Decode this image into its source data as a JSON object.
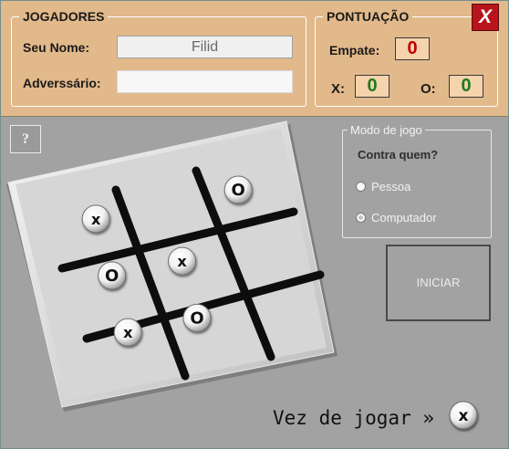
{
  "players": {
    "title": "JOGADORES",
    "name_label": "Seu Nome:",
    "name_value": "Filid",
    "opponent_label": "Adverssário:",
    "opponent_value": ""
  },
  "score": {
    "title": "PONTUAÇÃO",
    "draw_label": "Empate:",
    "draw_value": "0",
    "x_label": "X:",
    "x_value": "0",
    "o_label": "O:",
    "o_value": "0"
  },
  "close_label": "X",
  "help_label": "?",
  "board": {
    "cells": [
      [
        "X",
        "",
        "O"
      ],
      [
        "O",
        "X",
        ""
      ],
      [
        "X",
        "O",
        ""
      ]
    ]
  },
  "mode": {
    "title": "Modo de jogo",
    "question": "Contra quem?",
    "options": [
      "Pessoa",
      "Computador"
    ],
    "selected": "Computador"
  },
  "start_label": "INICIAR",
  "turn": {
    "label": "Vez de jogar »",
    "current": "X"
  },
  "colors": {
    "header_bg": "#e2b98a",
    "body_bg": "#a2a2a2",
    "draw_count": "#c00000",
    "win_count": "#1f7a1f",
    "close_bg": "#b8141c"
  }
}
